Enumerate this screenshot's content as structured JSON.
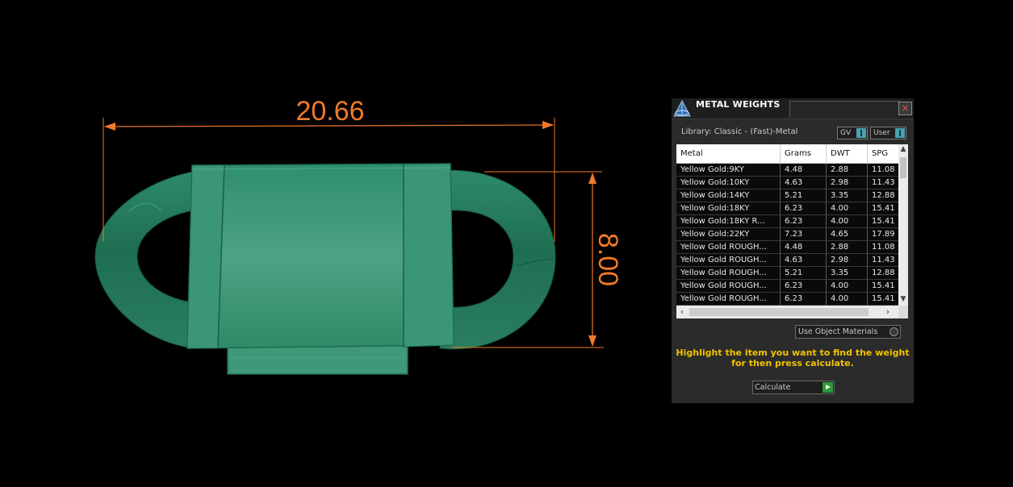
{
  "viewport": {
    "dimension_width": "20.66",
    "dimension_height": "8.00",
    "dimension_color": "#f07a2a",
    "model_color": "#2e8a68"
  },
  "panel": {
    "title": "METAL WEIGHTS",
    "close_glyph": "×",
    "library_label": "Library: Classic - (Fast)-Metal",
    "gv_toggle": "GV",
    "user_toggle": "User",
    "columns": [
      "Metal",
      "Grams",
      "DWT",
      "SPG"
    ],
    "rows": [
      [
        "Yellow Gold:9KY",
        "4.48",
        "2.88",
        "11.08"
      ],
      [
        "Yellow Gold:10KY",
        "4.63",
        "2.98",
        "11.43"
      ],
      [
        "Yellow Gold:14KY",
        "5.21",
        "3.35",
        "12.88"
      ],
      [
        "Yellow Gold:18KY",
        "6.23",
        "4.00",
        "15.41"
      ],
      [
        "Yellow Gold:18KY R...",
        "6.23",
        "4.00",
        "15.41"
      ],
      [
        "Yellow Gold:22KY",
        "7.23",
        "4.65",
        "17.89"
      ],
      [
        "Yellow Gold ROUGH...",
        "4.48",
        "2.88",
        "11.08"
      ],
      [
        "Yellow Gold ROUGH...",
        "4.63",
        "2.98",
        "11.43"
      ],
      [
        "Yellow Gold ROUGH...",
        "5.21",
        "3.35",
        "12.88"
      ],
      [
        "Yellow Gold ROUGH...",
        "6.23",
        "4.00",
        "15.41"
      ],
      [
        "Yellow Gold ROUGH...",
        "6.23",
        "4.00",
        "15.41"
      ]
    ],
    "use_object_materials": "Use Object Materials",
    "hint_line1": "Highlight the item you want to find the weight",
    "hint_line2": "for then press calculate.",
    "calculate_label": "Calculate"
  }
}
